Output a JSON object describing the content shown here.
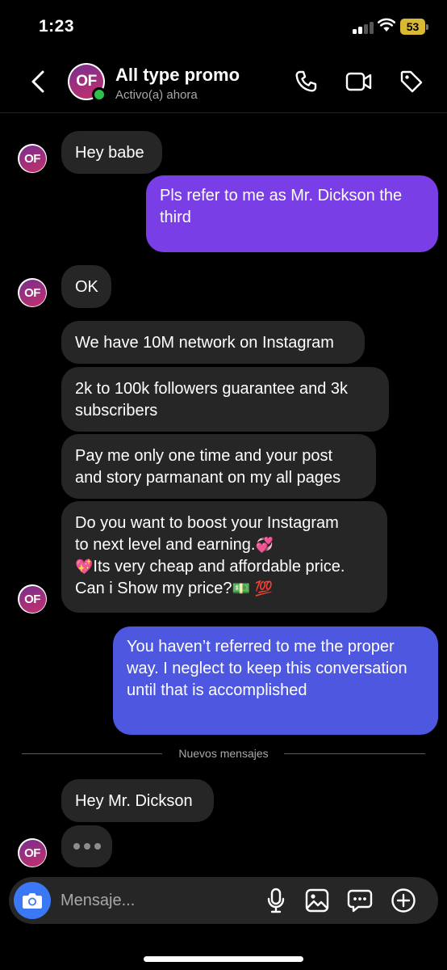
{
  "status_bar": {
    "time": "1:23",
    "battery": "53"
  },
  "header": {
    "contact_name": "All type promo",
    "contact_status": "Activo(a) ahora",
    "avatar_text": "OF"
  },
  "messages": [
    {
      "text": "Hey babe"
    },
    {
      "text": "Pls refer to me as Mr. Dickson the third"
    },
    {
      "text": "OK"
    },
    {
      "text": "We have 10M network on Instagram"
    },
    {
      "text": "2k to 100k followers guarantee and 3k subscribers"
    },
    {
      "text": "Pay me only one time and your post and story parmanant on my all pages"
    },
    {
      "line1": "Do you want  to boost your Instagram",
      "line2": "to next level and earning.",
      "emoji_a": "💞",
      "emoji_b": "💖",
      "line3": "Its very cheap and affordable price.",
      "line4": "Can i Show my price?",
      "emoji_c": "💵",
      "emoji_d": "💯"
    },
    {
      "text": "You haven’t referred to me the proper way. I neglect to keep this conversation until that is accomplished"
    },
    {
      "text": "Hey Mr. Dickson"
    }
  ],
  "divider": {
    "label": "Nuevos mensajes"
  },
  "composer": {
    "placeholder": "Mensaje..."
  },
  "colors": {
    "outgoing_1": "#7a3ee6",
    "outgoing_2": "#4d57e0",
    "incoming": "#262626",
    "online": "#2fbf4b",
    "battery": "#d9b932",
    "camera_button": "#3a78f5"
  },
  "icons": [
    "back-chevron-icon",
    "phone-icon",
    "video-camera-icon",
    "tag-icon",
    "camera-icon",
    "microphone-icon",
    "image-icon",
    "sticker-icon",
    "plus-icon"
  ]
}
